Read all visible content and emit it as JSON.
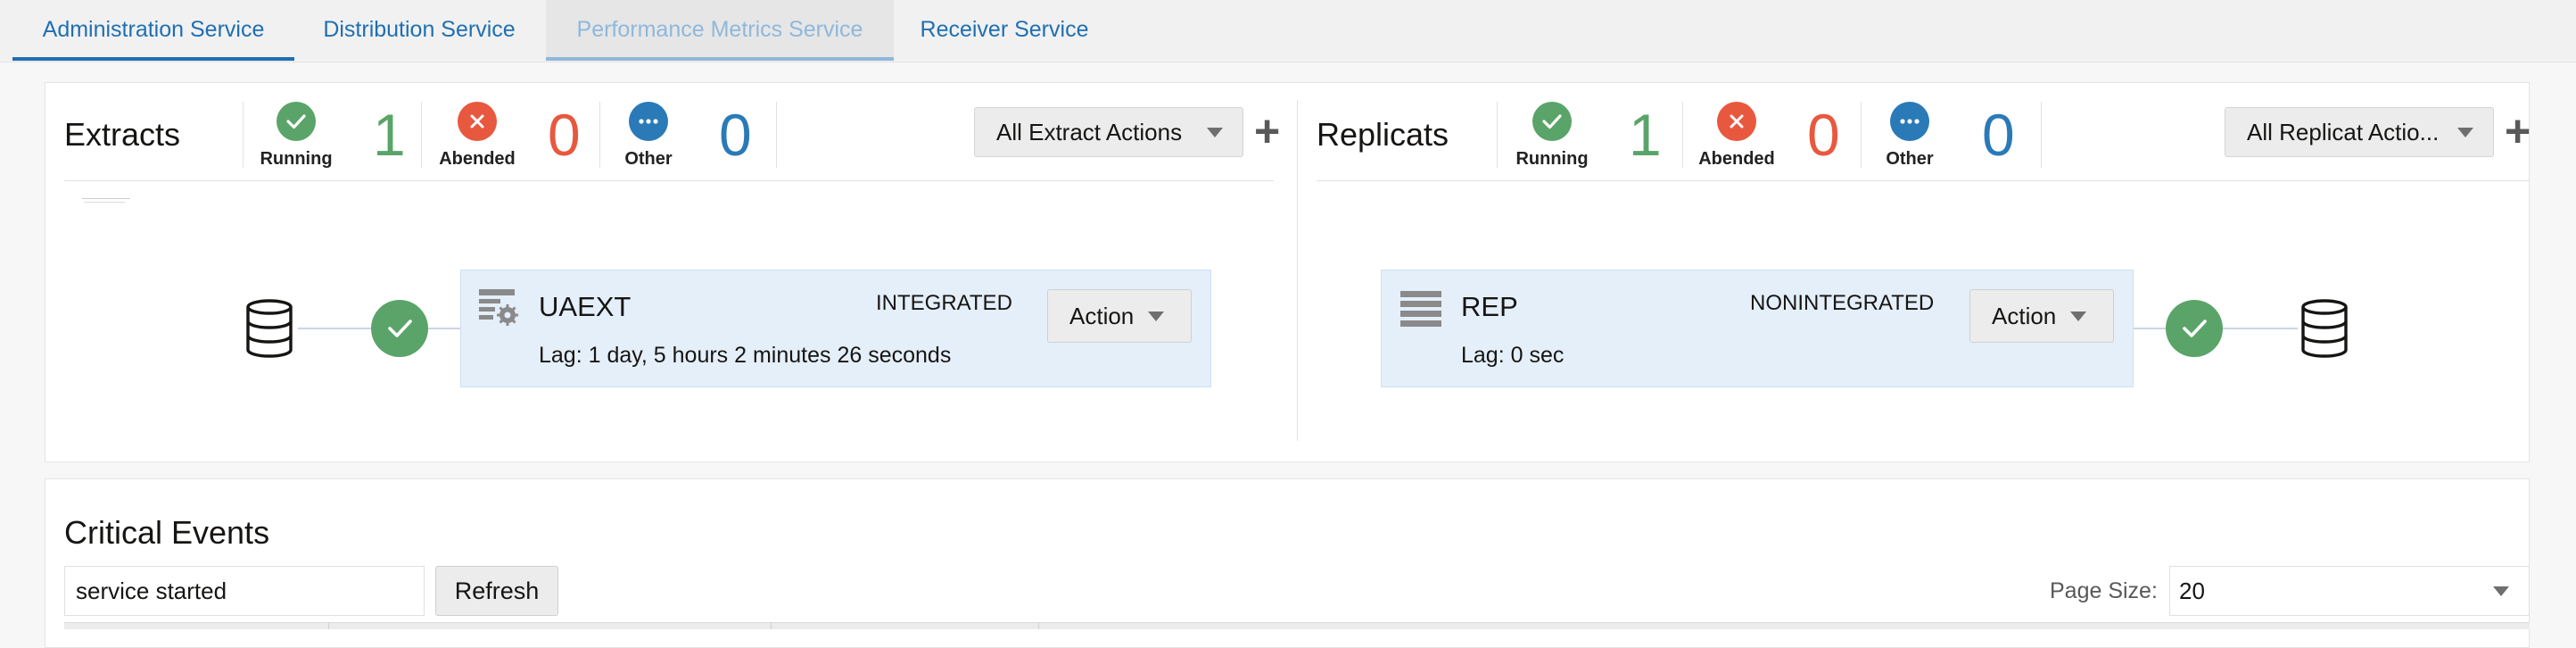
{
  "tabs": [
    {
      "label": "Administration Service",
      "state": "active"
    },
    {
      "label": "Distribution Service",
      "state": "normal"
    },
    {
      "label": "Performance Metrics Service",
      "state": "hover"
    },
    {
      "label": "Receiver Service",
      "state": "normal"
    }
  ],
  "extracts": {
    "title": "Extracts",
    "running": {
      "label": "Running",
      "count": "1"
    },
    "abended": {
      "label": "Abended",
      "count": "0"
    },
    "other": {
      "label": "Other",
      "count": "0"
    },
    "actions_label": "All Extract Actions",
    "process": {
      "name": "UAEXT",
      "type": "INTEGRATED",
      "lag": "Lag: 1 day, 5 hours 2 minutes 26 seconds",
      "action_label": "Action"
    }
  },
  "replicats": {
    "title": "Replicats",
    "running": {
      "label": "Running",
      "count": "1"
    },
    "abended": {
      "label": "Abended",
      "count": "0"
    },
    "other": {
      "label": "Other",
      "count": "0"
    },
    "actions_label": "All Replicat Actio...",
    "process": {
      "name": "REP",
      "type": "NONINTEGRATED",
      "lag": "Lag: 0 sec",
      "action_label": "Action"
    }
  },
  "critical_events": {
    "title": "Critical Events",
    "search_value": "service started",
    "refresh_label": "Refresh",
    "page_size_label": "Page Size:",
    "page_size_value": "20"
  },
  "colors": {
    "running": "#5aa469",
    "abended": "#e8583f",
    "other": "#2a7ab8",
    "link": "#1f6fb2",
    "card_bg": "#e4effa"
  },
  "icons": [
    "check-icon",
    "close-icon",
    "more-icon",
    "caret-down-icon",
    "plus-icon",
    "database-icon",
    "extract-gear-icon",
    "replicat-list-icon"
  ]
}
